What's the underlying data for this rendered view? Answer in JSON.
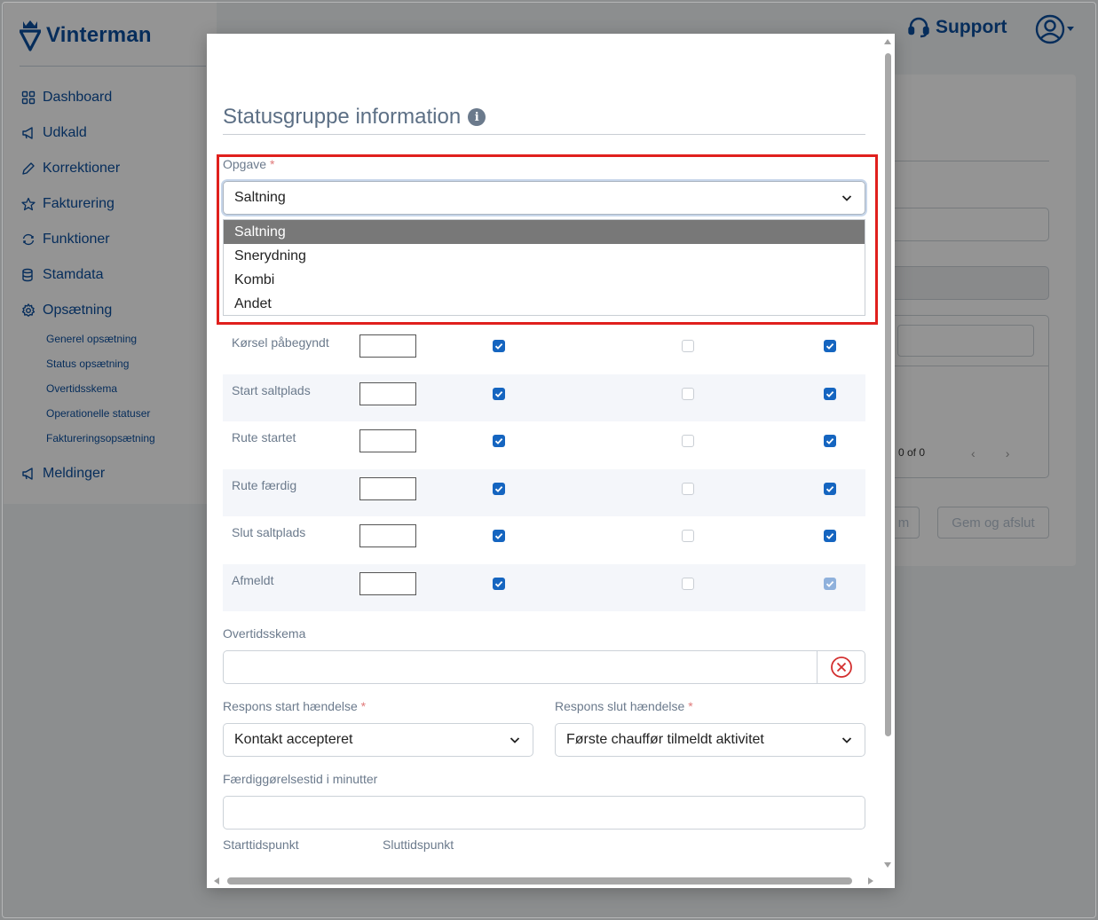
{
  "app": {
    "brand": "Vinterman",
    "support_label": "Support",
    "nav": [
      {
        "label": "Dashboard",
        "icon": "grid-icon"
      },
      {
        "label": "Udkald",
        "icon": "megaphone-icon"
      },
      {
        "label": "Korrektioner",
        "icon": "pencil-icon"
      },
      {
        "label": "Fakturering",
        "icon": "star-icon"
      },
      {
        "label": "Funktioner",
        "icon": "refresh-icon"
      },
      {
        "label": "Stamdata",
        "icon": "database-icon"
      },
      {
        "label": "Opsætning",
        "icon": "gear-icon"
      }
    ],
    "sub_nav": [
      "Generel opsætning",
      "Status opsætning",
      "Overtidsskema",
      "Operationelle statuser",
      "Faktureringsopsætning"
    ],
    "nav_bottom": {
      "label": "Meldinger",
      "icon": "megaphone-icon"
    },
    "bg_paging": "0 of 0",
    "bg_buttons": [
      "m",
      "Gem og afslut"
    ]
  },
  "modal": {
    "title": "Statusgruppe information",
    "opgave": {
      "label": "Opgave",
      "required_mark": "*",
      "value": "Saltning",
      "options": [
        "Saltning",
        "Snerydning",
        "Kombi",
        "Andet"
      ],
      "selected_index": 0
    },
    "status_rows": [
      {
        "name": "Kørsel påbegyndt",
        "c1": true,
        "c2": false,
        "c3": true
      },
      {
        "name": "Start saltplads",
        "c1": true,
        "c2": false,
        "c3": true
      },
      {
        "name": "Rute startet",
        "c1": true,
        "c2": false,
        "c3": true
      },
      {
        "name": "Rute færdig",
        "c1": true,
        "c2": false,
        "c3": true
      },
      {
        "name": "Slut saltplads",
        "c1": true,
        "c2": false,
        "c3": true
      },
      {
        "name": "Afmeldt",
        "c1": true,
        "c2": false,
        "c3": true
      }
    ],
    "overtid_label": "Overtidsskema",
    "respons_start": {
      "label": "Respons start hændelse",
      "required_mark": "*",
      "value": "Kontakt accepteret"
    },
    "respons_slut": {
      "label": "Respons slut hændelse",
      "required_mark": "*",
      "value": "Første chauffør tilmeldt aktivitet"
    },
    "minutes_label": "Færdiggørelsestid i minutter",
    "start_label": "Starttidspunkt",
    "slut_label": "Sluttidspunkt"
  },
  "colors": {
    "brand": "#0b4e9e",
    "checkbox": "#1565c0",
    "highlight": "#e0201d",
    "clear_icon": "#d32f2f"
  }
}
